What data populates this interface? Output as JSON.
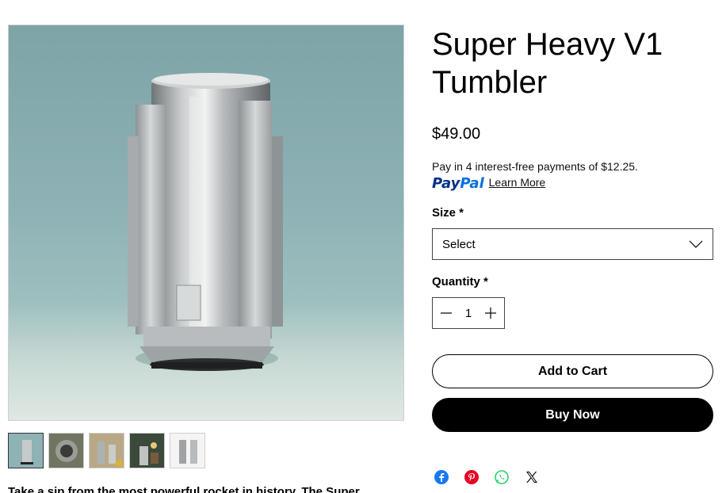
{
  "product": {
    "title": "Super Heavy V1 Tumbler",
    "price": "$49.00",
    "description_preview": "Take a sip from the most powerful rocket in history. The Super"
  },
  "paypal": {
    "message_line1": "Pay in 4 interest-free payments of",
    "message_amount": "$12.25.",
    "logo_pay": "Pay",
    "logo_pal": "Pal",
    "learn_more": "Learn More"
  },
  "options": {
    "size_label": "Size *",
    "size_selected": "Select",
    "quantity_label": "Quantity *",
    "quantity_value": "1"
  },
  "actions": {
    "add_to_cart": "Add to Cart",
    "buy_now": "Buy Now"
  },
  "share_icons": [
    "facebook-icon",
    "pinterest-icon",
    "whatsapp-icon",
    "x-icon"
  ],
  "gallery": {
    "thumbnail_count": 5,
    "selected_index": 0
  },
  "colors": {
    "facebook": "#1877f2",
    "pinterest": "#e60023",
    "whatsapp": "#25d366",
    "paypal_dark": "#003087",
    "paypal_light": "#0070e0"
  }
}
